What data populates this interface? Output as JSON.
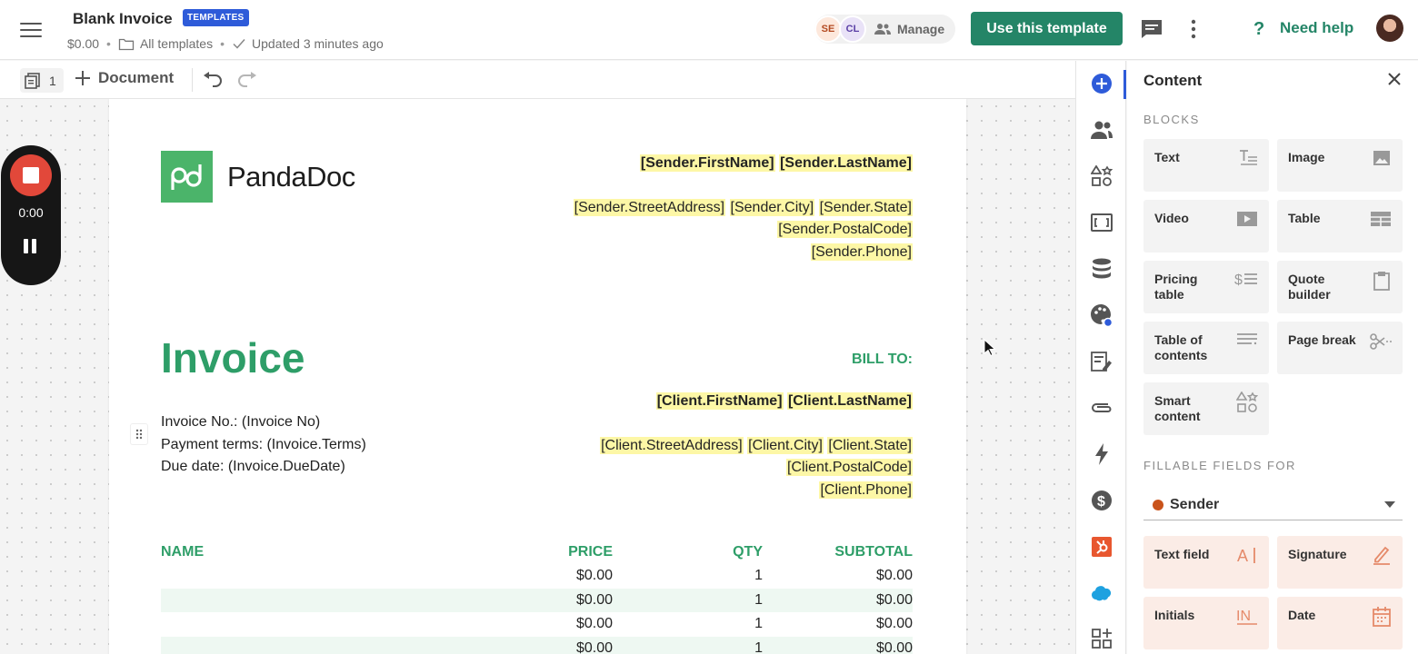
{
  "header": {
    "doc_title": "Blank Invoice",
    "badge": "TEMPLATES",
    "amount": "$0.00",
    "folder": "All templates",
    "updated": "Updated 3 minutes ago",
    "collaborators": [
      "SE",
      "CL"
    ],
    "manage_label": "Manage",
    "use_template_label": "Use this template",
    "help_label": "Need help"
  },
  "toolbar": {
    "page_count": "1",
    "add_document_label": "Document"
  },
  "recorder": {
    "time": "0:00"
  },
  "document": {
    "logo_text": "PandaDoc",
    "sender_first": "[Sender.FirstName]",
    "sender_last": "[Sender.LastName]",
    "sender_street": "[Sender.StreetAddress]",
    "sender_city": "[Sender.City]",
    "sender_state": "[Sender.State]",
    "sender_postal": "[Sender.PostalCode]",
    "sender_phone": "[Sender.Phone]",
    "invoice_title": "Invoice",
    "bill_to": "BILL TO:",
    "invoice_no": "Invoice No.: (Invoice No)",
    "payment_terms": "Payment terms: (Invoice.Terms)",
    "due_date": "Due date: (Invoice.DueDate)",
    "client_first": "[Client.FirstName]",
    "client_last": "[Client.LastName]",
    "client_street": "[Client.StreetAddress]",
    "client_city": "[Client.City]",
    "client_state": "[Client.State]",
    "client_postal": "[Client.PostalCode]",
    "client_phone": "[Client.Phone]",
    "table_headers": [
      "NAME",
      "PRICE",
      "QTY",
      "SUBTOTAL"
    ],
    "rows": [
      {
        "name": "",
        "price": "$0.00",
        "qty": "1",
        "subtotal": "$0.00"
      },
      {
        "name": "",
        "price": "$0.00",
        "qty": "1",
        "subtotal": "$0.00"
      },
      {
        "name": "",
        "price": "$0.00",
        "qty": "1",
        "subtotal": "$0.00"
      },
      {
        "name": "",
        "price": "$0.00",
        "qty": "1",
        "subtotal": "$0.00"
      }
    ]
  },
  "panel": {
    "title": "Content",
    "blocks_label": "BLOCKS",
    "blocks": {
      "text": "Text",
      "image": "Image",
      "video": "Video",
      "table": "Table",
      "pricing_table": "Pricing table",
      "quote_builder": "Quote builder",
      "table_of_contents": "Table of contents",
      "page_break": "Page break",
      "smart_content": "Smart content"
    },
    "fillable_label": "FILLABLE FIELDS FOR",
    "fillable_for": "Sender",
    "fields": {
      "text_field": "Text field",
      "signature": "Signature",
      "initials": "Initials",
      "date": "Date"
    }
  },
  "colors": {
    "brand_green": "#248567",
    "invoice_green": "#2e9e68",
    "highlight": "#fdf7a6",
    "accent_blue": "#2e5bd9",
    "recorder_red": "#e2483a",
    "sender_dot": "#c9531b"
  }
}
